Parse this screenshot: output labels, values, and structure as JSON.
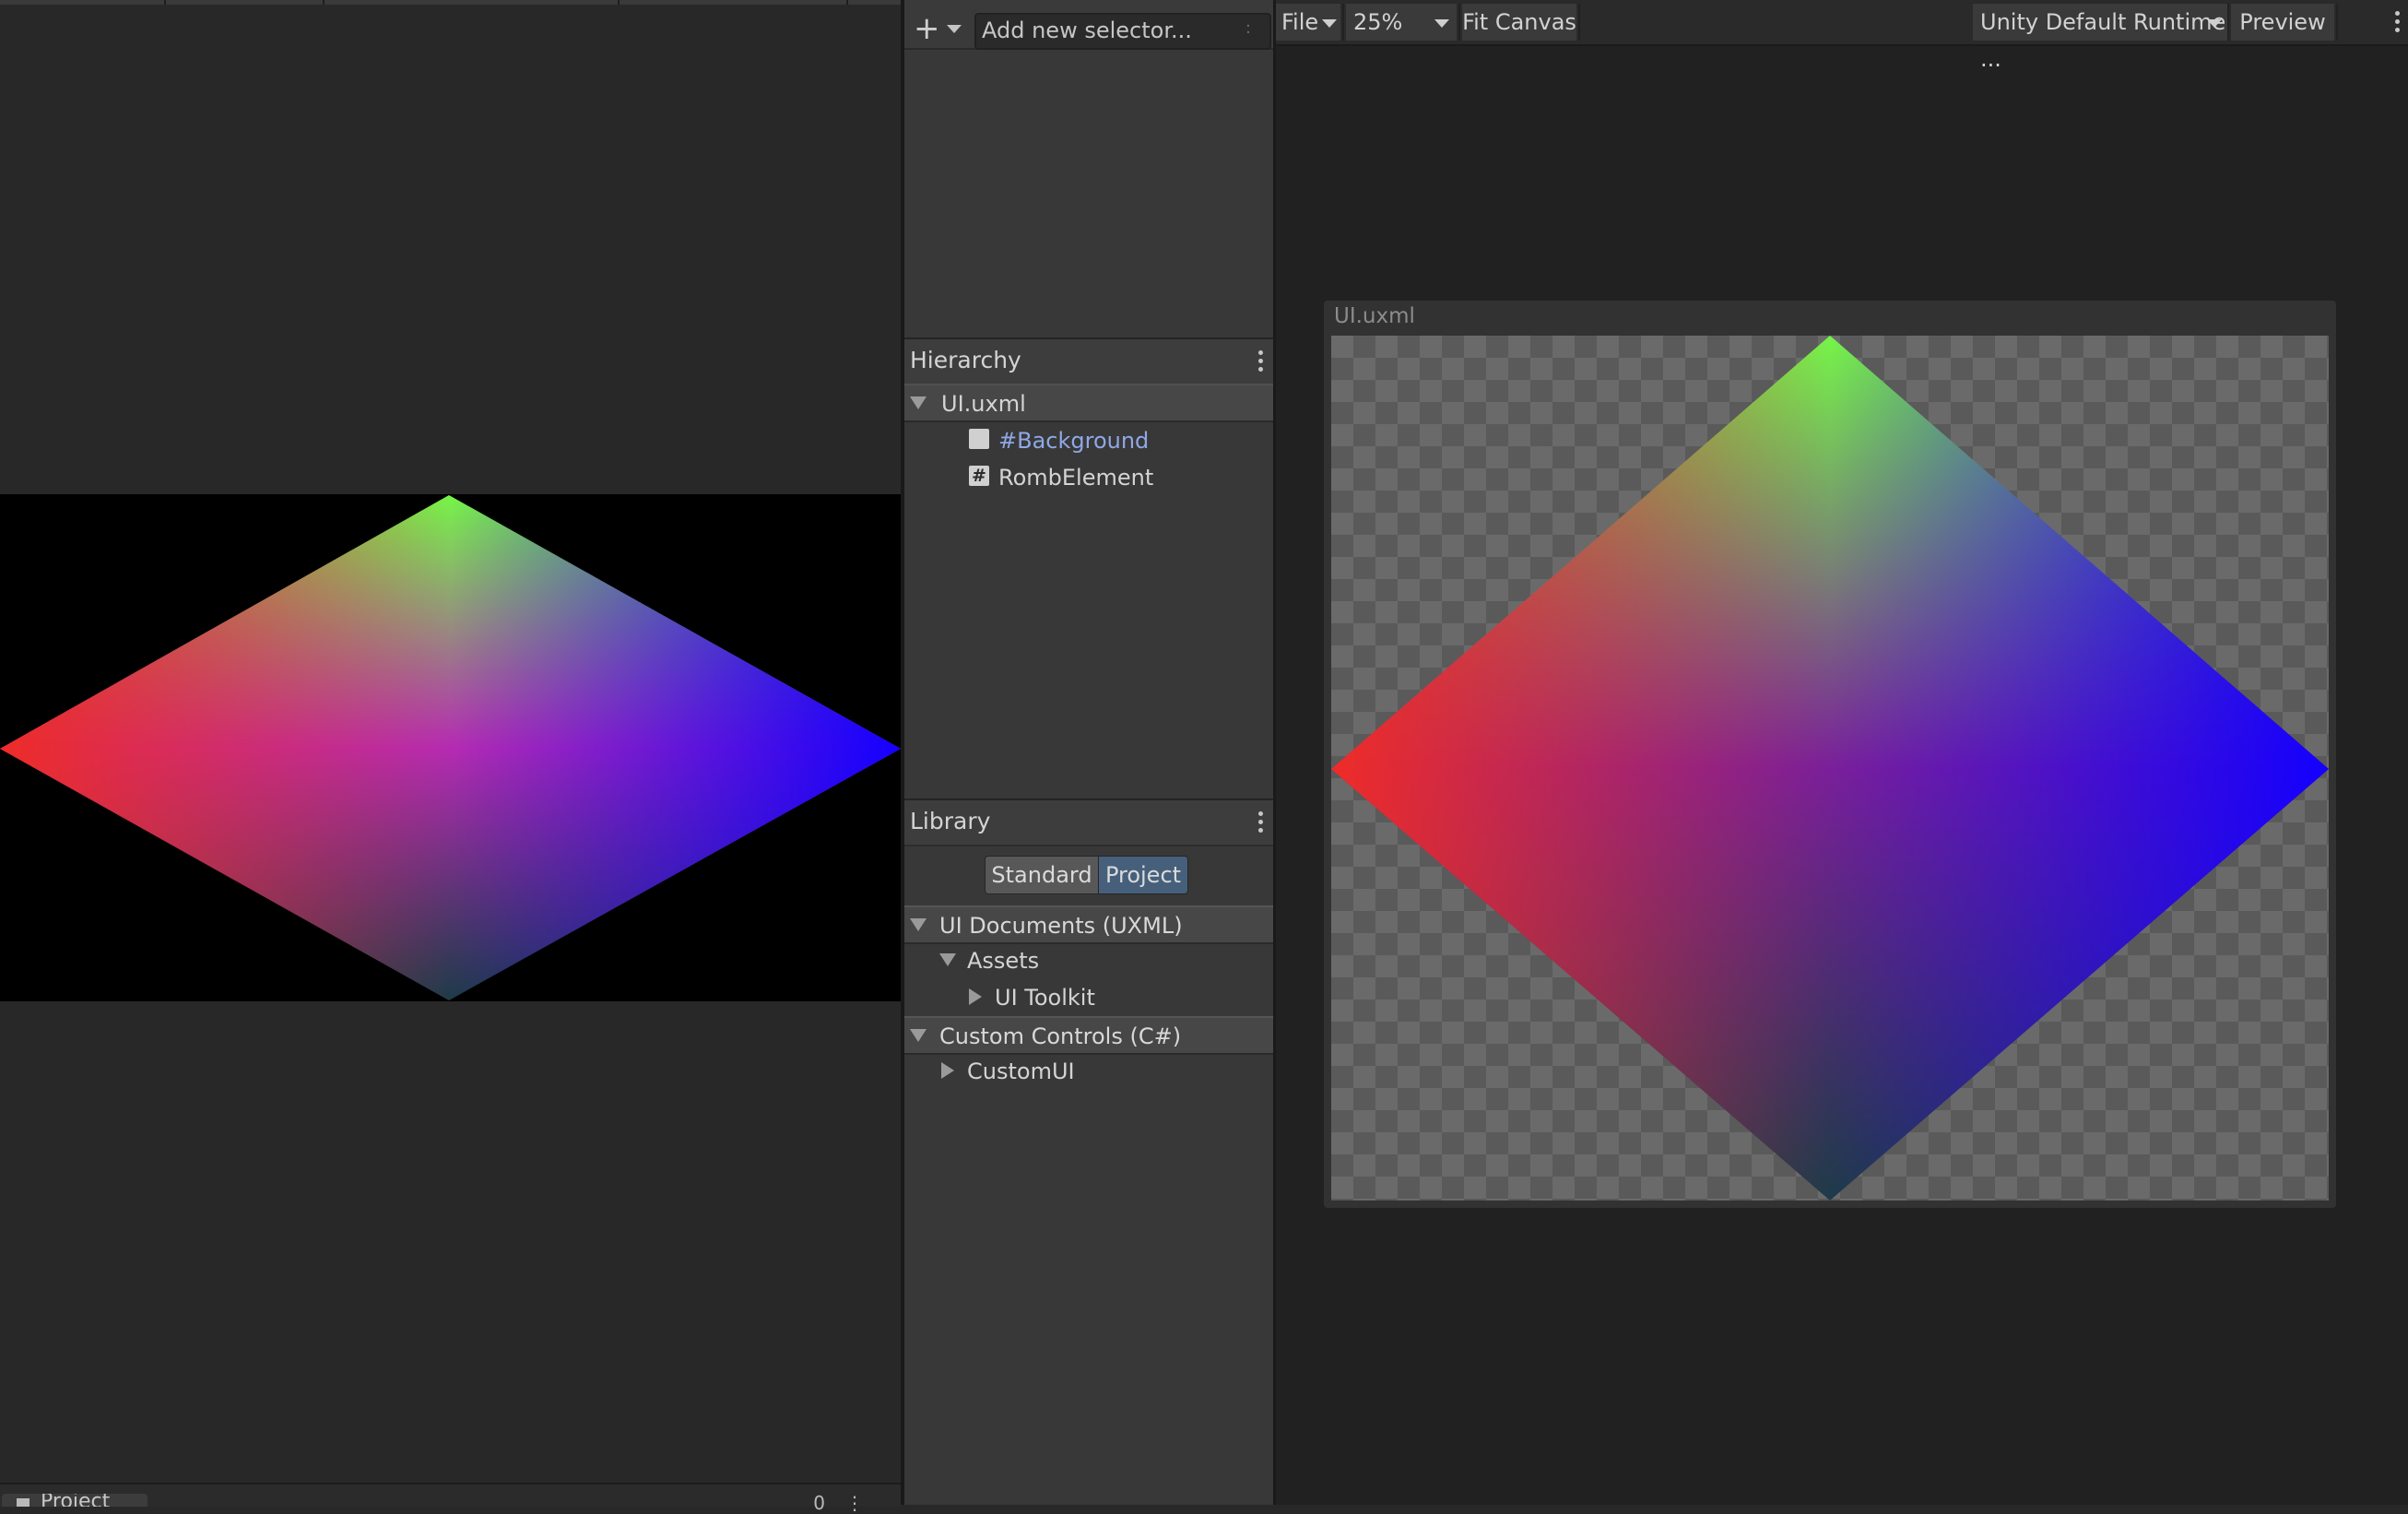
{
  "bottom_bar": {
    "project_tab_label": "Project",
    "count_label": "0"
  },
  "selectors": {
    "add_label": "+",
    "input_placeholder": "Add new selector...",
    "more_glyph": ":"
  },
  "hierarchy": {
    "title": "Hierarchy",
    "root": "UI.uxml",
    "children": [
      {
        "label": "#Background",
        "icon": "blank-element-icon",
        "color": "#8fa8e6"
      },
      {
        "label": "RombElement",
        "icon": "hash-element-icon",
        "color": "#d4d4d4"
      }
    ]
  },
  "library": {
    "title": "Library",
    "tabs": [
      "Standard",
      "Project"
    ],
    "active_tab": "Project",
    "categories": [
      {
        "label": "UI Documents (UXML)",
        "children": [
          {
            "label": "Assets",
            "children": [
              {
                "label": "UI Toolkit"
              }
            ]
          }
        ]
      },
      {
        "label": "Custom Controls (C#)",
        "children": [
          {
            "label": "CustomUI"
          }
        ]
      }
    ]
  },
  "canvas_toolbar": {
    "file_menu": "File",
    "zoom": "25%",
    "fit_canvas": "Fit Canvas",
    "theme": "Unity Default Runtime ...",
    "preview": "Preview"
  },
  "document": {
    "title": "UI.uxml"
  },
  "colors": {
    "background": "#282828",
    "panel": "#383838",
    "canvas_bg": "#212121",
    "selected_tab": "#46607c",
    "selector_link": "#8fa8e6",
    "vertex_top": "#76f548",
    "vertex_left": "#ee2c28",
    "vertex_right": "#1400ff",
    "vertex_bottom": "#1e3b48"
  }
}
